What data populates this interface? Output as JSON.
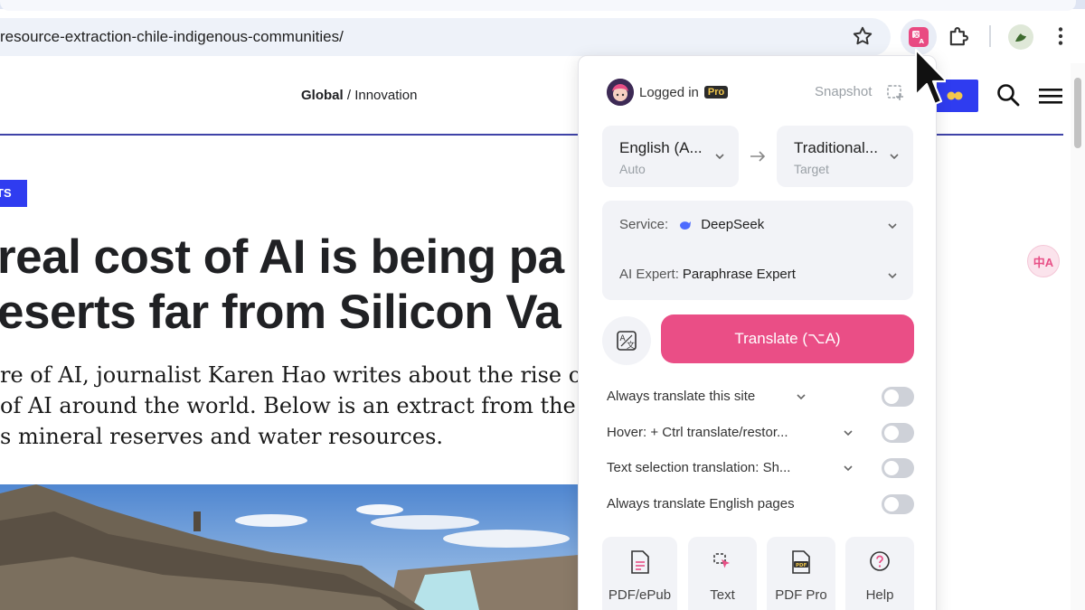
{
  "browser": {
    "url": "resource-extraction-chile-indigenous-communities/"
  },
  "site": {
    "breadcrumb_primary": "Global",
    "breadcrumb_sep": " / ",
    "breadcrumb_secondary": "Innovation",
    "tag_label": "TS",
    "headline_line1": "real cost of AI is being pa",
    "headline_line2": "eserts far from Silicon Va",
    "standfirst_line1": "re of AI, journalist Karen Hao writes about the rise o",
    "standfirst_line2": "of AI around the world. Below is an extract from the",
    "standfirst_line3": "s mineral reserves and water resources.",
    "floating_translate_glyph": "中A"
  },
  "popup": {
    "logged_in": "Logged in",
    "pro_badge": "Pro",
    "snapshot": "Snapshot",
    "source_lang": "English (A...",
    "source_sub": "Auto",
    "target_lang": "Traditional...",
    "target_sub": "Target",
    "service_label": "Service:",
    "service_value": "DeepSeek",
    "expert_label": "AI Expert:",
    "expert_value": "Paraphrase Expert",
    "translate_button": "Translate (⌥A)",
    "options": [
      {
        "label": "Always translate this site",
        "has_dropdown": true,
        "enabled": false
      },
      {
        "label": "Hover:  + Ctrl translate/restor...",
        "has_dropdown": true,
        "enabled": false
      },
      {
        "label": "Text selection translation:  Sh...",
        "has_dropdown": true,
        "enabled": false
      },
      {
        "label": "Always translate English pages",
        "has_dropdown": false,
        "enabled": false
      }
    ],
    "tools": [
      {
        "label": "PDF/ePub",
        "icon": "document-icon"
      },
      {
        "label": "Text",
        "icon": "cursor-select-icon"
      },
      {
        "label": "PDF Pro",
        "icon": "pdf-icon"
      },
      {
        "label": "Help",
        "icon": "help-icon"
      }
    ]
  },
  "colors": {
    "accent_pink": "#ea4e86",
    "site_blue": "#2f3cf0",
    "rule_navy": "#3f43a8"
  }
}
